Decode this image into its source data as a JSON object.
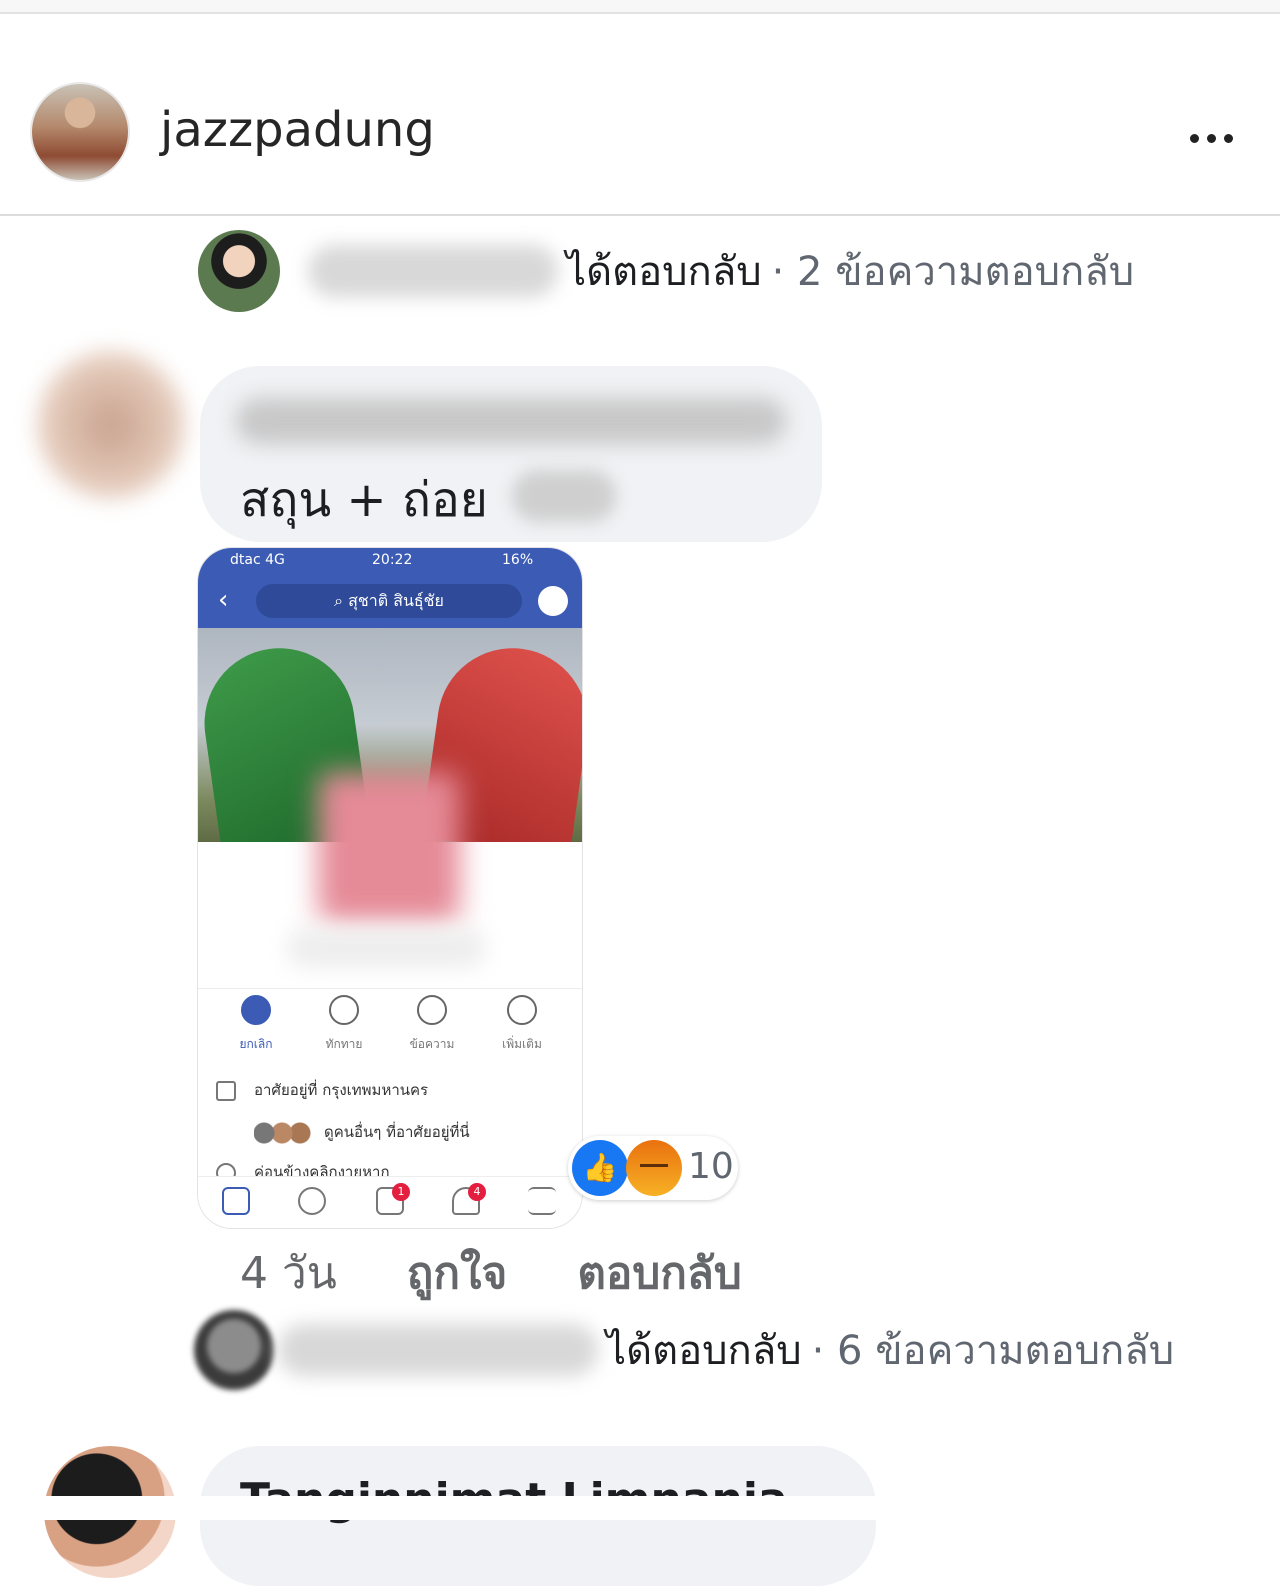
{
  "header": {
    "username": "jazzpadung",
    "more_icon": "more-horizontal-icon"
  },
  "reply_summary_1": {
    "replied_text": "ได้ตอบกลับ",
    "count_text": "· 2 ข้อความตอบกลับ"
  },
  "comment": {
    "text": "สถุน + ถ่อย",
    "phone_screenshot": {
      "carrier": "dtac 4G",
      "time": "20:22",
      "battery": "16%",
      "search_value": "สุชาติ สินธุ์ชัย",
      "actions": [
        "ยกเลิก",
        "ทักทาย",
        "ข้อความ",
        "เพิ่มเติม"
      ],
      "lives_in": "อาศัยอยู่ที่ กรุงเทพมหานคร",
      "friends_here": "ดูคนอื่นๆ ที่อาศัยอยู่ที่นี่",
      "relationship": "ค่อนข้างคลิกงายหาก",
      "badges": [
        "1",
        "4"
      ]
    },
    "reactions": {
      "icons": [
        "like-icon",
        "angry-icon"
      ],
      "count": "10"
    },
    "meta": {
      "age": "4 วัน",
      "like_label": "ถูกใจ",
      "reply_label": "ตอบกลับ"
    }
  },
  "reply_summary_2": {
    "replied_text": "ได้ตอบกลับ",
    "count_text": "· 6 ข้อความตอบกลับ"
  },
  "next_comment": {
    "name": "Tanginnimat Limnania"
  },
  "colors": {
    "facebook_blue": "#3b5bb5",
    "like_blue": "#1877f2",
    "bubble_gray": "#f0f2f5",
    "secondary_text": "#65676b"
  }
}
